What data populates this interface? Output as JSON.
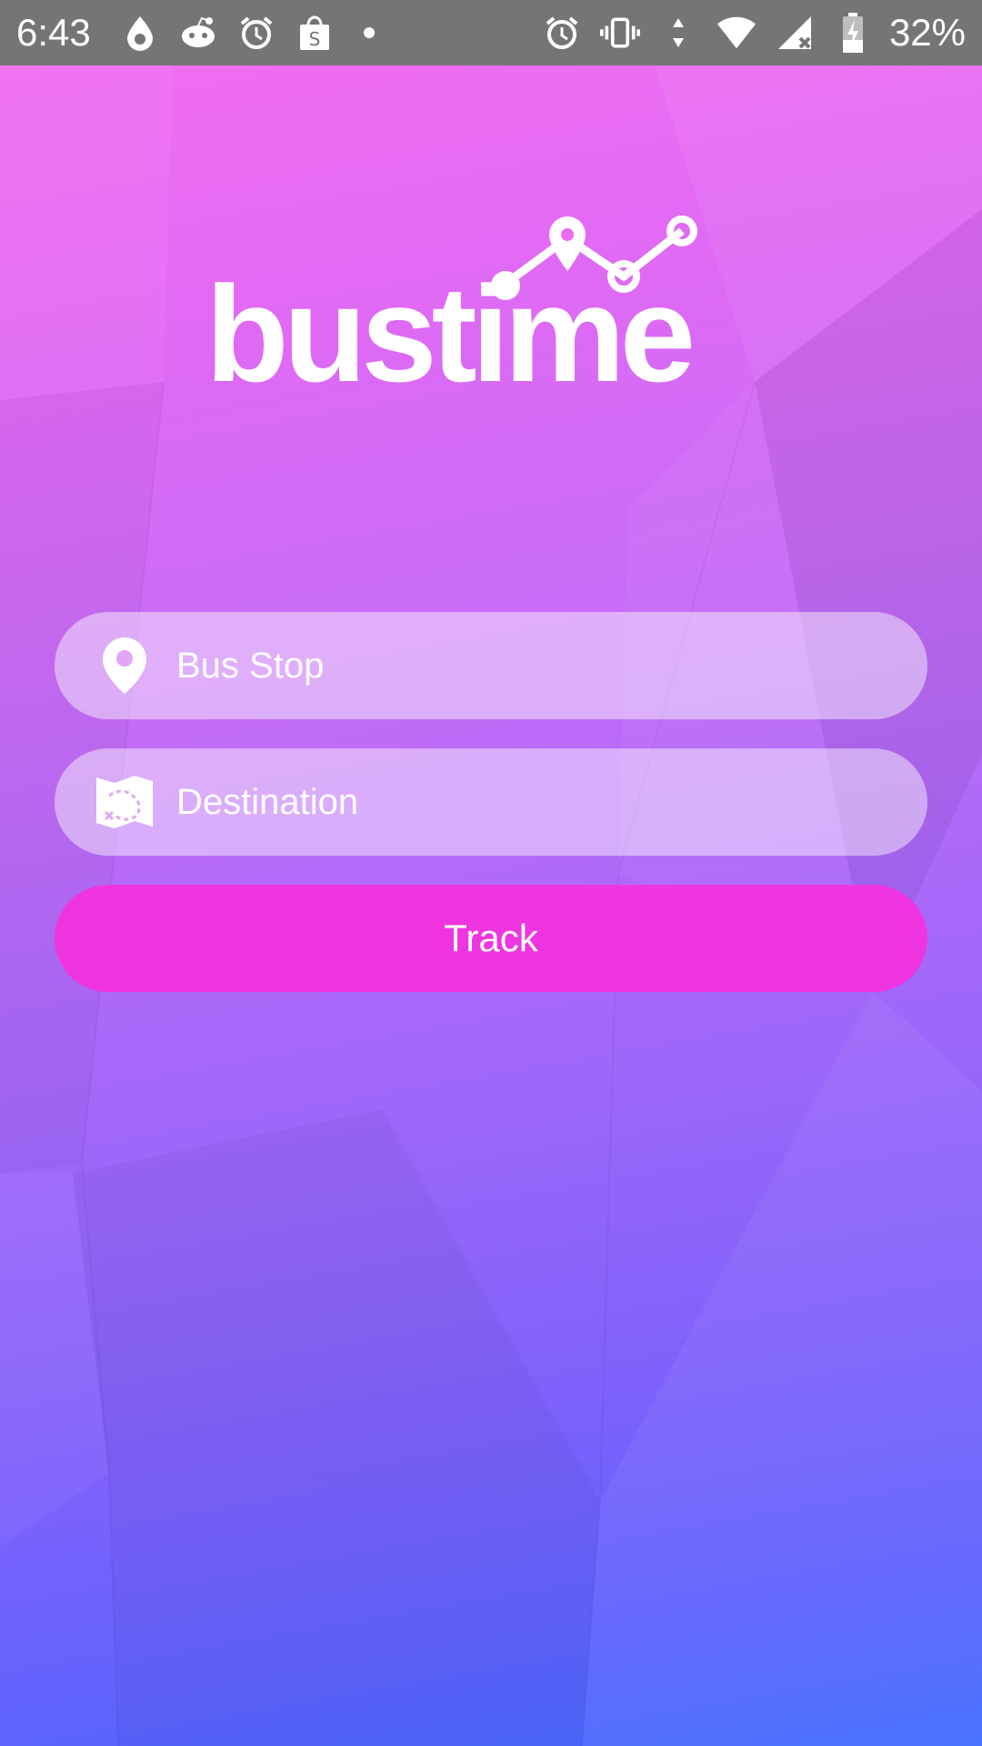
{
  "status_bar": {
    "time": "6:43",
    "battery_percent": "32%",
    "left_icons": [
      "drop-icon",
      "reddit-icon",
      "alarm-icon",
      "shopping-bag-icon",
      "notification-dot"
    ],
    "right_icons": [
      "alarm-icon",
      "vibrate-icon",
      "data-arrows-icon",
      "wifi-icon",
      "signal-icon",
      "battery-charging-icon"
    ]
  },
  "app": {
    "logo_text": "bustime"
  },
  "form": {
    "bus_stop": {
      "placeholder": "Bus Stop",
      "value": "",
      "icon": "location-pin-icon"
    },
    "destination": {
      "placeholder": "Destination",
      "value": "",
      "icon": "map-icon"
    },
    "track_label": "Track"
  },
  "colors": {
    "gradient_top": "#f56ef0",
    "gradient_bottom": "#3f6bff",
    "button": "#ef35e0",
    "status_bar": "#757575"
  }
}
